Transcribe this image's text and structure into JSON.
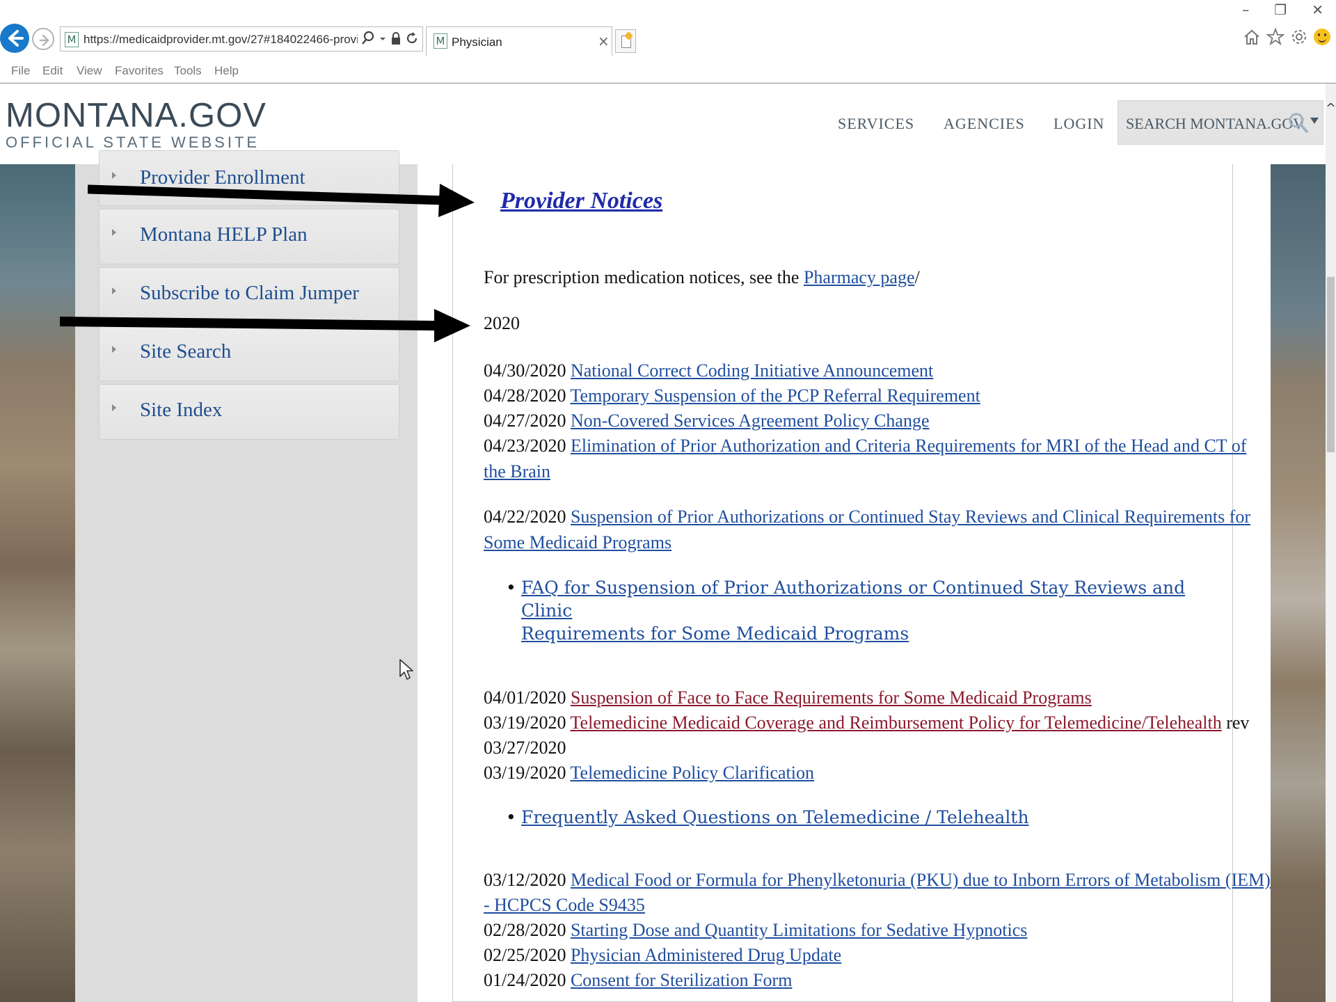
{
  "browser": {
    "url": "https://medicaidprovider.mt.gov/27#184022466-provid",
    "tab_title": "Physician",
    "tab_close": "×",
    "favicon_letter": "M",
    "window_controls": [
      "–",
      "❐",
      "✕"
    ],
    "menu": [
      "File",
      "Edit",
      "View",
      "Favorites",
      "Tools",
      "Help"
    ]
  },
  "site": {
    "logo_main": "MONTANA.GOV",
    "logo_sub": "OFFICIAL STATE WEBSITE",
    "nav": [
      "SERVICES",
      "AGENCIES",
      "LOGIN"
    ],
    "search_placeholder": "SEARCH MONTANA.GOV"
  },
  "sidebar": {
    "items": [
      {
        "label": "Provider Enrollment"
      },
      {
        "label": "Montana HELP Plan"
      },
      {
        "label": "Subscribe to Claim Jumper"
      },
      {
        "label": "Site Search"
      },
      {
        "label": "Site Index"
      }
    ]
  },
  "content": {
    "title": "Provider Notices",
    "pharmacy_prefix": "For prescription medication notices, see the ",
    "pharmacy_link": "Pharmacy page",
    "pharmacy_suffix": "/",
    "year": "2020",
    "notices": [
      {
        "date": "04/30/2020",
        "title": "National Correct Coding Initiative Announcement"
      },
      {
        "date": "04/28/2020",
        "title": "Temporary Suspension of the PCP Referral Requirement"
      },
      {
        "date": "04/27/2020",
        "title": "Non-Covered Services Agreement Policy Change"
      },
      {
        "date": "04/23/2020",
        "title_line1": "Elimination of Prior Authorization and Criteria Requirements for MRI of the Head and CT of",
        "title_line2": "the Brain"
      },
      {
        "date": "04/22/2020",
        "title_line1": "Suspension of Prior Authorizations or Continued Stay Reviews and Clinical Requirements for",
        "title_line2": "Some Medicaid Programs"
      },
      {
        "bullet_line1": "FAQ for Suspension of Prior Authorizations or Continued Stay Reviews and Clinic",
        "bullet_line2": "Requirements for Some Medicaid Programs"
      },
      {
        "date": "04/01/2020",
        "title": "Suspension of Face to Face Requirements for Some Medicaid Programs"
      },
      {
        "date": "03/19/2020",
        "title": "Telemedicine Medicaid Coverage and Reimbursement Policy for Telemedicine/Telehealth",
        "suffix": " rev",
        "line2": "03/27/2020"
      },
      {
        "date": "03/19/2020",
        "title": "Telemedicine Policy Clarification "
      },
      {
        "bullet": "Frequently Asked Questions on Telemedicine / Telehealth"
      },
      {
        "date": "03/12/2020",
        "title_line1": "Medical Food or Formula for Phenylketonuria (PKU) due to Inborn Errors of Metabolism (IEM)",
        "title_line2": "- HCPCS Code S9435"
      },
      {
        "date": "02/28/2020",
        "title": "Starting Dose and Quantity Limitations for Sedative Hypnotics"
      },
      {
        "date": "02/25/2020",
        "title": "Physician Administered Drug Update"
      },
      {
        "date": "01/24/2020",
        "title": "Consent for Sterilization Form"
      }
    ]
  },
  "icons": {
    "back": "back-arrow-icon",
    "forward": "forward-arrow-icon",
    "search": "search-icon",
    "lock": "lock-icon",
    "refresh": "refresh-icon",
    "home": "home-icon",
    "favorites": "star-icon",
    "settings": "gear-icon",
    "feedback": "smiley-icon"
  },
  "colors": {
    "link": "#1f4e9e",
    "visited_link": "#8b1a2b",
    "title_link": "#1f2aa8",
    "sidebar_text": "#1f4e8f",
    "browser_accent": "#1979ca"
  }
}
